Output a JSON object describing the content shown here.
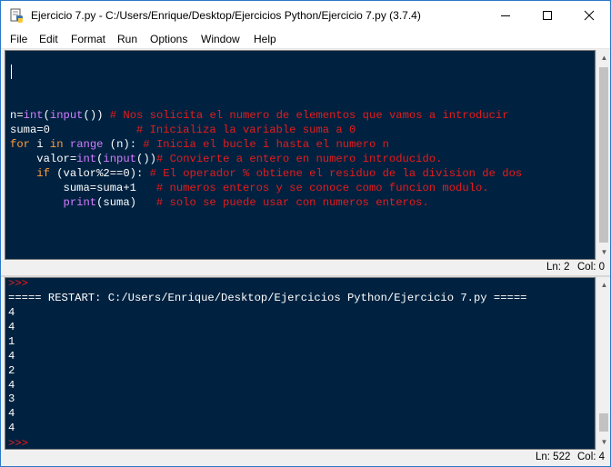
{
  "window": {
    "title": "Ejercicio 7.py - C:/Users/Enrique/Desktop/Ejercicios Python/Ejercicio 7.py (3.7.4)"
  },
  "menu": [
    "File",
    "Edit",
    "Format",
    "Run",
    "Options",
    "Window",
    "Help"
  ],
  "editor": {
    "lines": [
      [
        {
          "t": "n=",
          "c": "wt"
        },
        {
          "t": "int",
          "c": "bi"
        },
        {
          "t": "(",
          "c": "wt"
        },
        {
          "t": "input",
          "c": "bi"
        },
        {
          "t": "()) ",
          "c": "wt"
        },
        {
          "t": "# Nos solicita el numero de elementos que vamos a introducir",
          "c": "cm"
        }
      ],
      [
        {
          "t": "suma=0             ",
          "c": "wt"
        },
        {
          "t": "# Inicializa la variable suma a 0",
          "c": "cm"
        }
      ],
      [
        {
          "t": "for",
          "c": "kw"
        },
        {
          "t": " i ",
          "c": "wt"
        },
        {
          "t": "in",
          "c": "kw"
        },
        {
          "t": " ",
          "c": "wt"
        },
        {
          "t": "range",
          "c": "bi"
        },
        {
          "t": " (n): ",
          "c": "wt"
        },
        {
          "t": "# Inicia el bucle i hasta el numero n",
          "c": "cm"
        }
      ],
      [
        {
          "t": "    valor=",
          "c": "wt"
        },
        {
          "t": "int",
          "c": "bi"
        },
        {
          "t": "(",
          "c": "wt"
        },
        {
          "t": "input",
          "c": "bi"
        },
        {
          "t": "())",
          "c": "wt"
        },
        {
          "t": "# Convierte a entero en numero introducido.",
          "c": "cm"
        }
      ],
      [
        {
          "t": "    ",
          "c": "wt"
        },
        {
          "t": "if",
          "c": "kw"
        },
        {
          "t": " (valor%2==0): ",
          "c": "wt"
        },
        {
          "t": "# El operador % obtiene el residuo de la division de dos",
          "c": "cm"
        }
      ],
      [
        {
          "t": "        suma=suma+1   ",
          "c": "wt"
        },
        {
          "t": "# numeros enteros y se conoce como funcion modulo.",
          "c": "cm"
        }
      ],
      [
        {
          "t": "        ",
          "c": "wt"
        },
        {
          "t": "print",
          "c": "bi"
        },
        {
          "t": "(suma)   ",
          "c": "wt"
        },
        {
          "t": "# solo se puede usar con numeros enteros.",
          "c": "cm"
        }
      ]
    ],
    "status": {
      "ln": "Ln: 2",
      "col": "Col: 0"
    }
  },
  "shell": {
    "prompt": ">>>",
    "restart": "===== RESTART: C:/Users/Enrique/Desktop/Ejercicios Python/Ejercicio 7.py =====",
    "outputs": [
      "4",
      "4",
      "1",
      "4",
      "2",
      "4",
      "3",
      "4",
      "4"
    ],
    "status": {
      "ln": "Ln: 522",
      "col": "Col: 4"
    }
  },
  "colors": {
    "background": "#002240",
    "keyword": "#ff9d3a",
    "builtin": "#d27cff",
    "comment": "#e81b1b",
    "text": "#ffffff"
  }
}
